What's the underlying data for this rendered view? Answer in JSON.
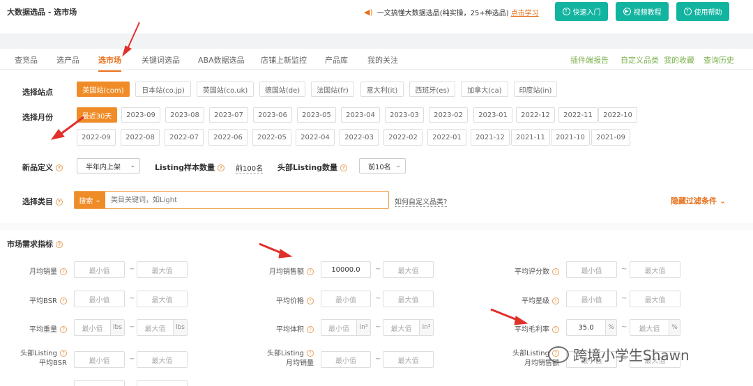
{
  "header": {
    "app_title": "大数据选品 - 选市场",
    "promo_text": "一文搞懂大数据选品(纯实操，25+种选品)",
    "promo_link": "点击学习",
    "buttons": [
      {
        "label": "快速入门",
        "icon": "rocket-icon"
      },
      {
        "label": "视频教程",
        "icon": "video-icon"
      },
      {
        "label": "使用帮助",
        "icon": "help-icon"
      }
    ]
  },
  "tabs": [
    "查竞品",
    "选产品",
    "选市场",
    "关键词选品",
    "ABA数据选品",
    "店铺上新监控",
    "产品库",
    "我的关注"
  ],
  "active_tab": "选市场",
  "right_tabs": [
    "插件端报告",
    "自定义品类",
    "我的收藏",
    "查询历史"
  ],
  "site": {
    "label": "选择站点",
    "options": [
      "美国站(com)",
      "日本站(co.jp)",
      "英国站(co.uk)",
      "德国站(de)",
      "法国站(fr)",
      "意大利(it)",
      "西班牙(es)",
      "加拿大(ca)",
      "印度站(in)"
    ]
  },
  "month": {
    "label": "选择月份",
    "row1": [
      "最近30天",
      "2023-09",
      "2023-08",
      "2023-07",
      "2023-06",
      "2023-05",
      "2023-04",
      "2023-03",
      "2023-02",
      "2023-01",
      "2022-12",
      "2022-11",
      "2022-10"
    ],
    "row2": [
      "2022-09",
      "2022-08",
      "2022-07",
      "2022-06",
      "2022-05",
      "2022-04",
      "2022-03",
      "2022-02",
      "2022-01",
      "2021-12",
      "2021-11",
      "2021-10",
      "2021-09"
    ]
  },
  "newdef": {
    "label": "新品定义",
    "value": "半年内上架",
    "listing_label": "Listing样本数量",
    "listing_value": "前100名",
    "head_label": "头部Listing数量",
    "head_value": "前10名"
  },
  "category": {
    "label": "选择类目",
    "search_btn": "搜索",
    "placeholder": "类目关键词，如Light",
    "custom_link": "如何自定义品类?",
    "hide_filter": "隐藏过滤条件"
  },
  "market": {
    "title": "市场需求指标",
    "min": "最小值",
    "max": "最大值",
    "tilde": "~",
    "labels": {
      "avg_sales": "月均销量",
      "avg_revenue": "月均销售额",
      "avg_rating_count": "平均评分数",
      "avg_bsr": "平均BSR",
      "avg_price": "平均价格",
      "avg_star": "平均星级",
      "avg_weight": "平均重量",
      "avg_volume": "平均体积",
      "avg_margin": "平均毛利率",
      "head_bsr_1": "头部Listing",
      "head_bsr_2": "平均BSR",
      "head_sales_1": "头部Listing",
      "head_sales_2": "月均销量",
      "head_rev_1": "头部Listing",
      "head_rev_2": "月均销售额"
    },
    "revenue_value": "10000.0",
    "margin_value": "35.0",
    "units": {
      "lbs": "lbs",
      "in3": "in³",
      "pct": "%"
    }
  },
  "watermark": "跨境小学生Shawn",
  "colors": {
    "accent": "#f08c28",
    "teal": "#12b4a0",
    "green": "#7ab04a",
    "arrow": "#e0302a"
  }
}
